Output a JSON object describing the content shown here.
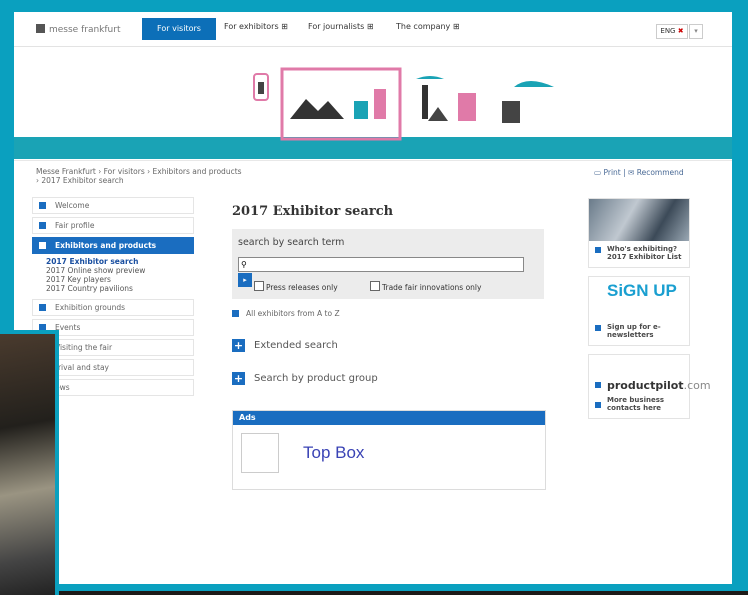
{
  "header": {
    "logo": "messe frankfurt",
    "nav": [
      {
        "label": "For visitors",
        "active": true
      },
      {
        "label": "For exhibitors ⊞"
      },
      {
        "label": "For journalists ⊞"
      },
      {
        "label": "The company ⊞"
      }
    ],
    "lang": "ENG",
    "lang_dropdown": "▾"
  },
  "breadcrumb": {
    "line1": "Messe Frankfurt › For visitors › Exhibitors and products",
    "line2": "› 2017 Exhibitor search"
  },
  "tools": {
    "print": "Print",
    "recommend": "Recommend"
  },
  "sidebar": {
    "items": [
      {
        "label": "Welcome"
      },
      {
        "label": "Fair profile"
      },
      {
        "label": "Exhibitors and products",
        "active": true
      },
      {
        "label": "Exhibition grounds"
      },
      {
        "label": "Events"
      },
      {
        "label": "Visiting the fair"
      },
      {
        "label": "rrival and stay"
      },
      {
        "label": "ews"
      }
    ],
    "sub": [
      "2017 Exhibitor search",
      "2017 Online show preview",
      "2017 Key players",
      "2017 Country pavilions"
    ]
  },
  "main": {
    "title": "2017 Exhibitor search",
    "search_label": "search by search term",
    "search_value": "",
    "go": "▸",
    "check1": "Press releases only",
    "check2": "Trade fair innovations only",
    "az_link": "All exhibitors from A to Z",
    "extended": "Extended search",
    "product_group": "Search by product group",
    "ads_header": "Ads",
    "ads_text": "Top Box"
  },
  "right": {
    "box1": "Who's exhibiting? 2017 Exhibitor List",
    "signup": "SiGN UP",
    "signup_text": "Sign up for e-newsletters",
    "pp_brand": "productpilot",
    "pp_suffix": ".com",
    "pp_text": "More business contacts here"
  }
}
